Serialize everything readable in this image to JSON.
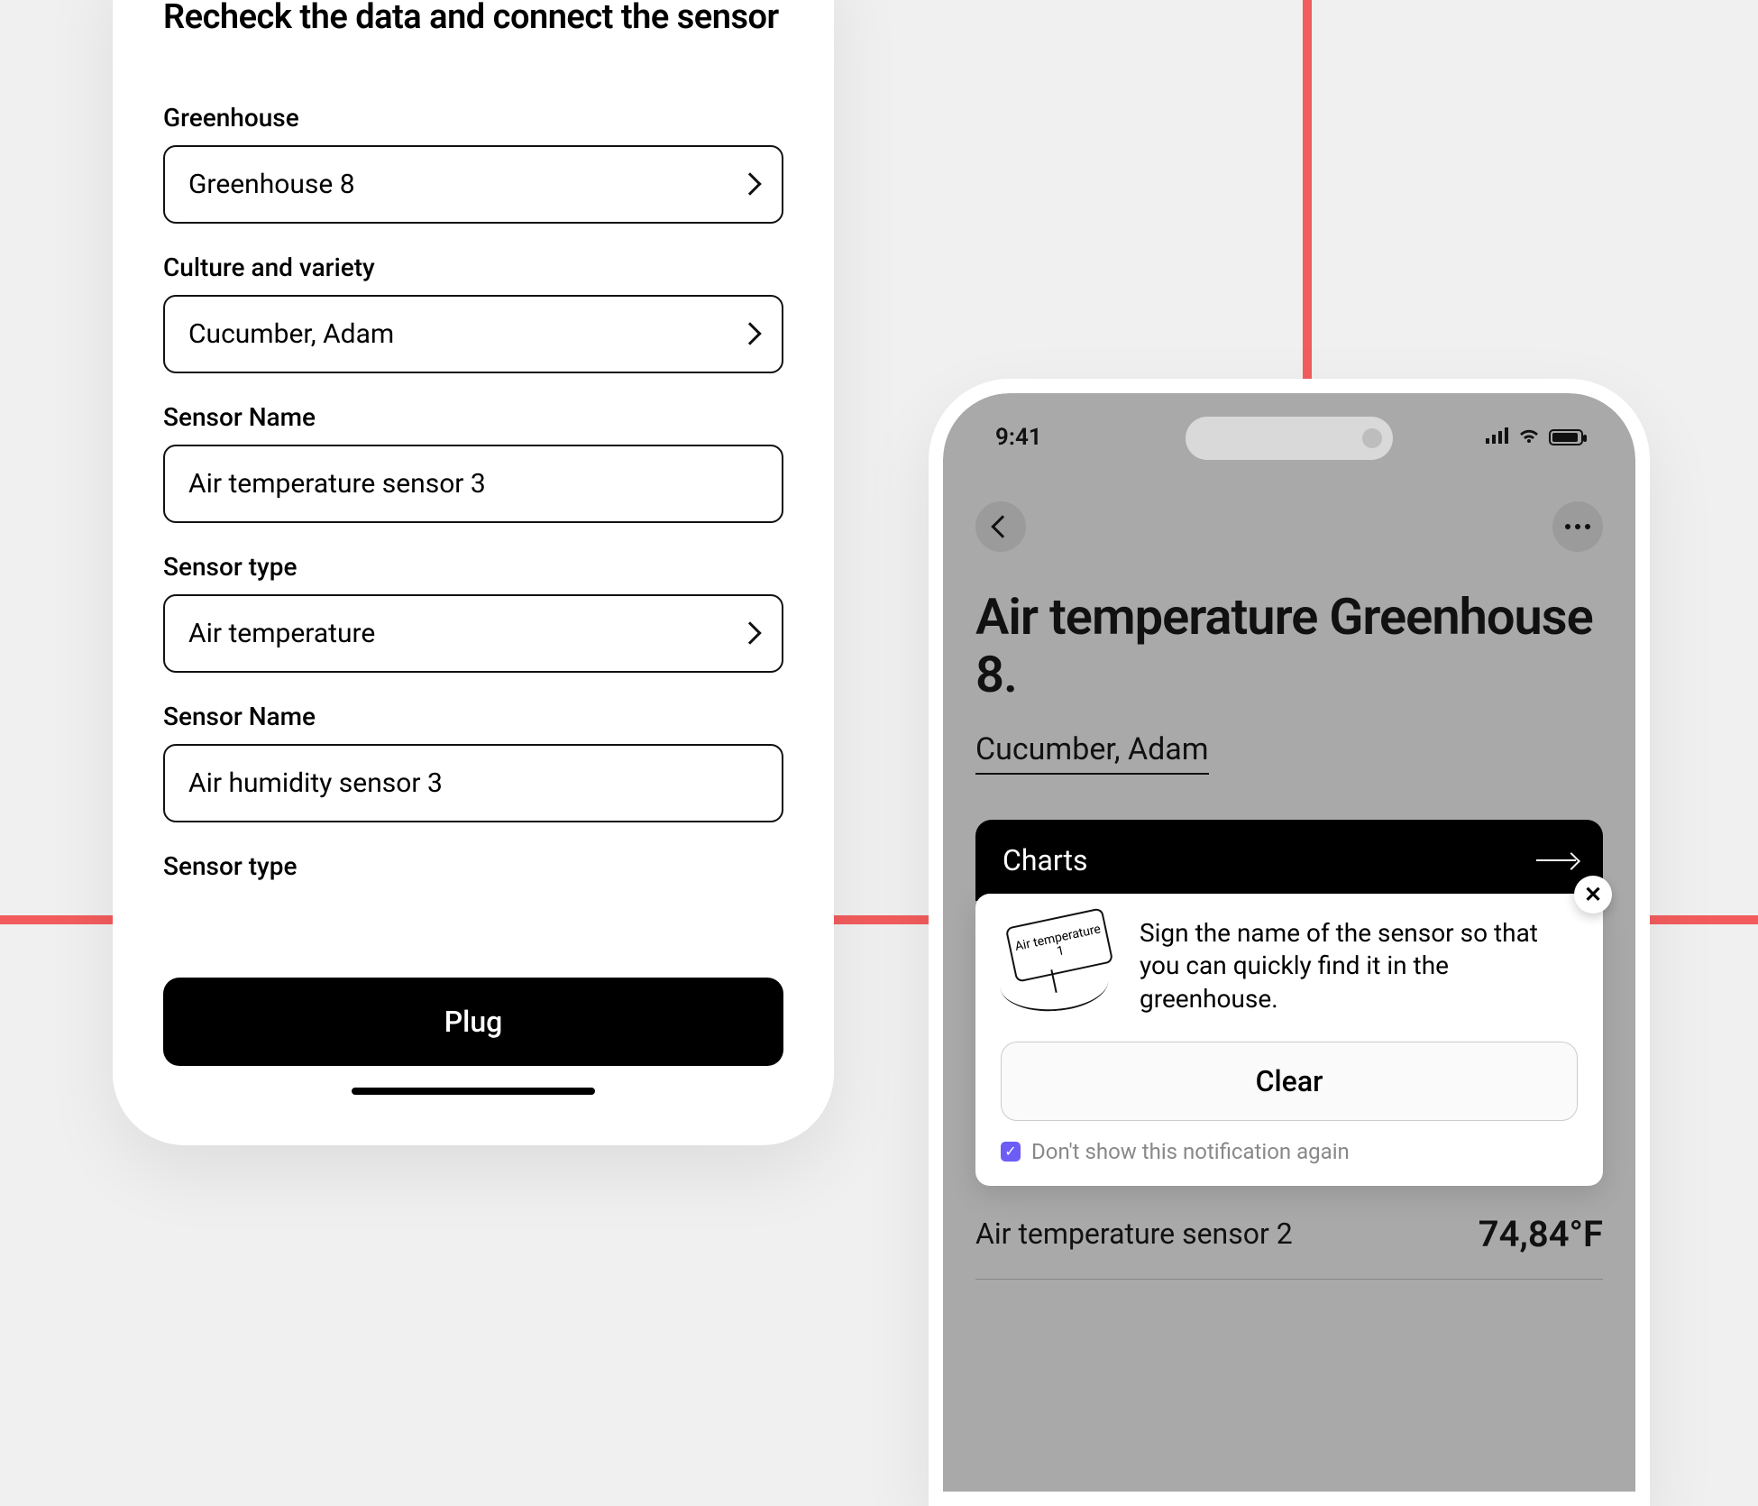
{
  "left": {
    "title": "Recheck the data and connect the sensor",
    "fields": [
      {
        "label": "Greenhouse",
        "value": "Greenhouse 8",
        "select": true
      },
      {
        "label": "Culture and variety",
        "value": "Cucumber, Adam",
        "select": true
      },
      {
        "label": "Sensor Name",
        "value": "Air temperature sensor 3",
        "select": false
      },
      {
        "label": "Sensor type",
        "value": "Air temperature",
        "select": true
      },
      {
        "label": "Sensor Name",
        "value": "Air humidity sensor 3",
        "select": false
      },
      {
        "label": "Sensor type",
        "value": "",
        "select": true
      }
    ],
    "cta": "Plug"
  },
  "right": {
    "time": "9:41",
    "title": "Air temperature Greenhouse 8.",
    "subtitle": "Cucumber, Adam",
    "charts_label": "Charts",
    "popup": {
      "sign_label": "Air temperature 1",
      "text": "Sign the name of the sensor so that you can quickly find it in the greenhouse.",
      "clear": "Clear",
      "dont_show": "Don't show this notification again"
    },
    "sensor_row": {
      "name": "Air temperature sensor 2",
      "value": "74,84°F"
    }
  }
}
